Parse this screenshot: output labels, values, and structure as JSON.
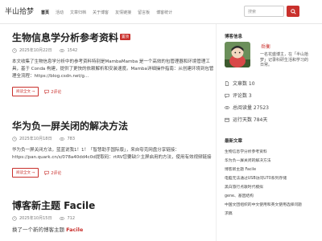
{
  "site": {
    "name": "半山拾梦"
  },
  "nav": {
    "items": [
      "首页",
      "活动",
      "文章归档",
      "关于博客",
      "友情链接",
      "留言板",
      "博客统计"
    ],
    "active_index": 0
  },
  "search": {
    "placeholder": "搜索"
  },
  "posts": [
    {
      "title": "生物信息学分析参考资料",
      "badge": "置顶",
      "date": "2025年10月22日",
      "views": "1542",
      "excerpt": "本文收集了生物信息学分析中的参考资料特别是MambaMamba 是一个高效的包管理器和环境管理工具，基于 Conda 构建，提供了更快的依赖解析和安装速度。Mamba详细操作指南：从创建环境到包管理全流程：https://blog.csdn.net/g...",
      "readmore": "阅读全文 →",
      "comments": "2评论"
    },
    {
      "title": "华为负一屏关闭的解决方法",
      "date": "2025年10月18日",
      "views": "783",
      "excerpt": "华为负一屏关闭方法，蓝蓝说我1！1！「智慧助手国际版」，来自夸克网盘分享链接：https://pan.quark.cn/s/078a40dd4c0d提取码：rtRV您要缺少主屏启用的方法，使用有效视频链接",
      "readmore": "阅读全文 →",
      "comments": "2评论"
    },
    {
      "title": "博客新主题 Facile",
      "date": "2025年10月15日",
      "views": "712",
      "excerpt_before": "换了一个新的博客主题 ",
      "excerpt_em": "Facile"
    }
  ],
  "sidebar": {
    "info_heading": "博客信息",
    "author": "岳衡",
    "bio": "一名花盛博主，在「半山拾梦」记录科研生活和学习的日常。",
    "stats": [
      {
        "icon": "file-icon",
        "label": "文章数 10"
      },
      {
        "icon": "comment-icon",
        "label": "评论数 3"
      },
      {
        "icon": "eye-icon",
        "label": "总阅读量 27523"
      },
      {
        "icon": "calendar-icon",
        "label": "运行天数 784天"
      }
    ],
    "recent_heading": "最新文章",
    "recent": [
      "生物信息学分析参考资料",
      "华为负一屏关闭的解决方法",
      "博客新主题 Facile",
      "电脑无法通过USB访问U70系列存储",
      "黑白旅行点歌时代模拟",
      "gene、基因结构",
      "中国文团组织的中文使用和英文使用选择问题",
      "求稿"
    ]
  },
  "colors": {
    "accent": "#c9302c"
  }
}
